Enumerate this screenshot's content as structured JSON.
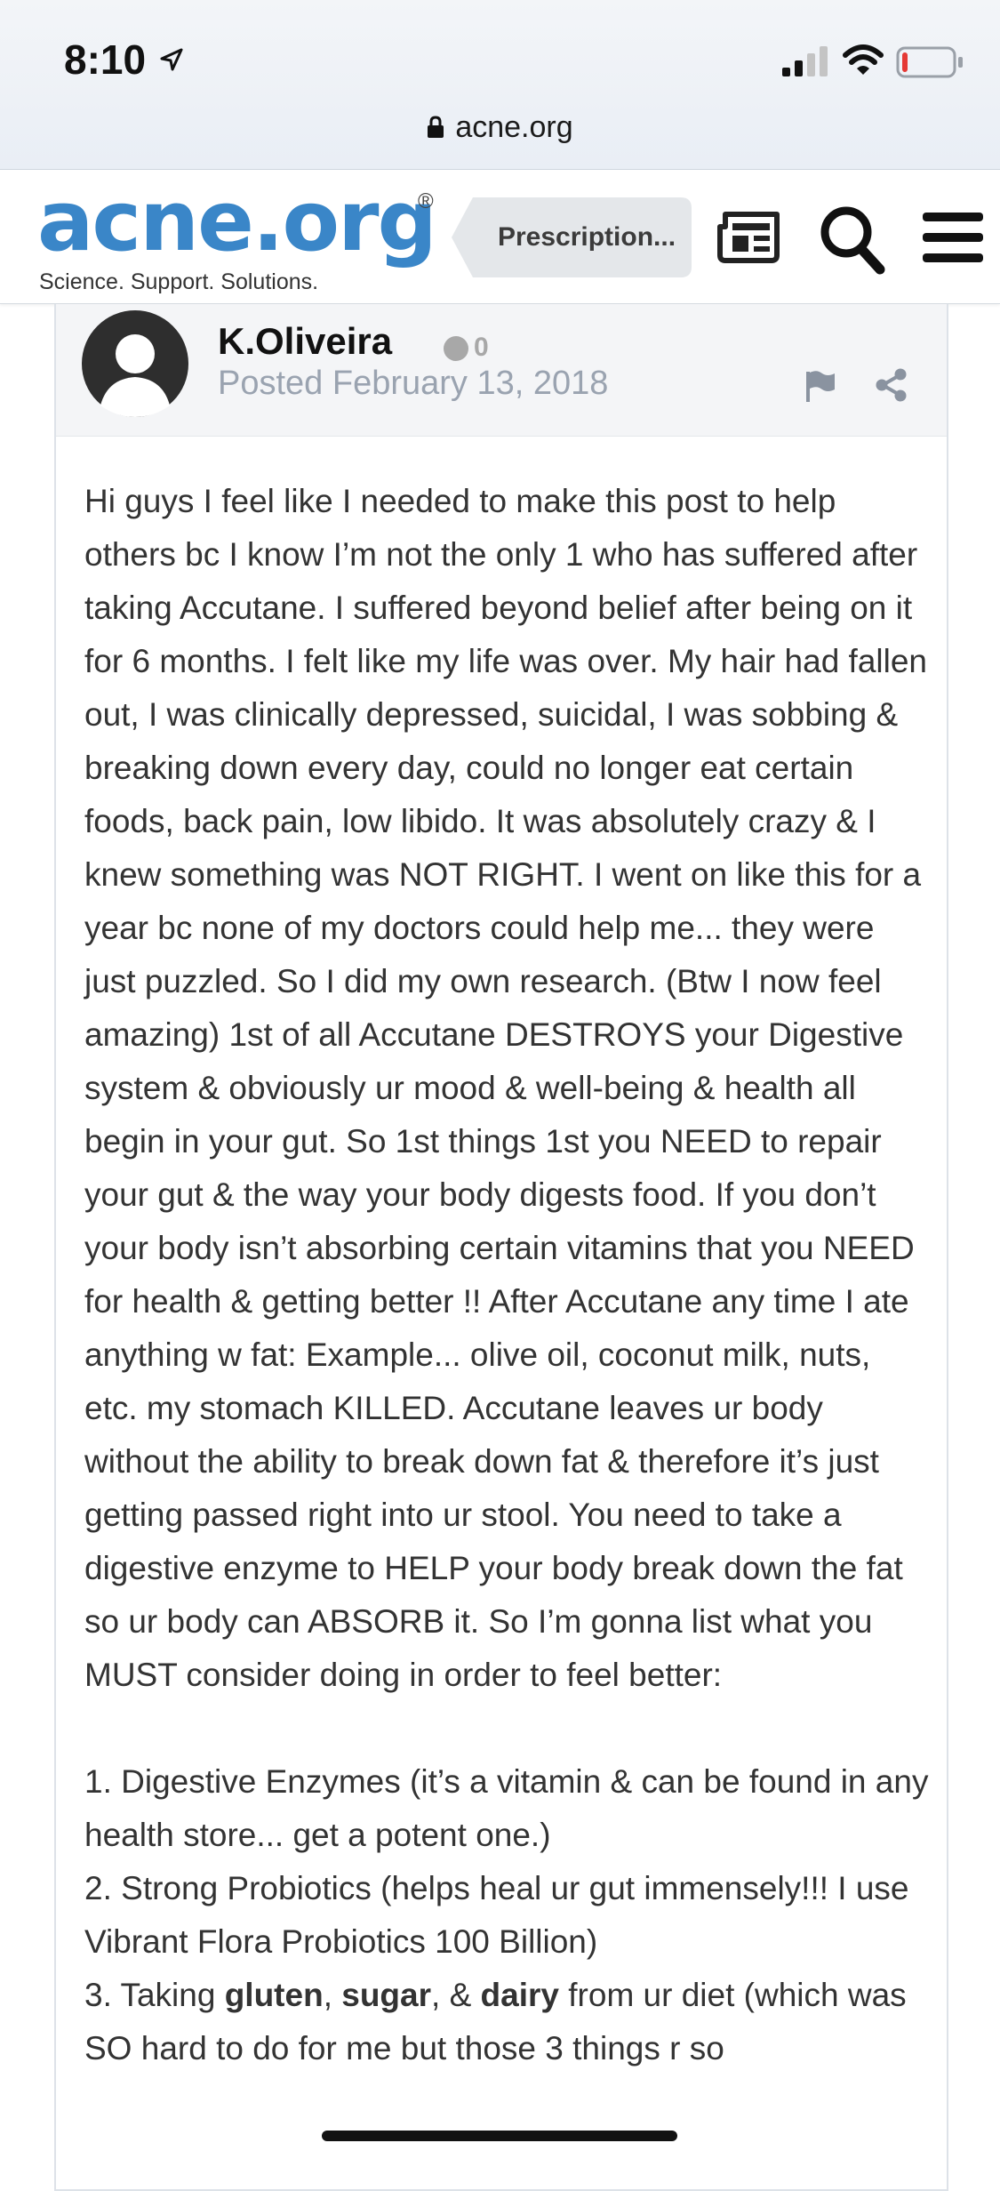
{
  "status_bar": {
    "time": "8:10",
    "icons": [
      "location-arrow-icon",
      "signal-icon",
      "wifi-icon",
      "battery-low-icon"
    ]
  },
  "browser": {
    "url": "acne.org"
  },
  "site_header": {
    "logo": "acne.org",
    "logo_mark": "®",
    "tagline": "Science. Support. Solutions.",
    "forum_button": "Prescription...",
    "icons": [
      "newspaper-icon",
      "search-icon",
      "hamburger-menu-icon"
    ],
    "logo_color": "#3a86c8"
  },
  "post": {
    "author": "K.Oliveira",
    "reputation": "0",
    "posted": "Posted February 13, 2018",
    "paragraph": "Hi guys I feel like I needed to make this post to help others bc I know I’m not the only 1 who has suffered after taking Accutane. I suffered beyond belief after being on it for 6 months. I felt like my life was over. My hair had fallen out, I was clinically depressed, suicidal, I was sobbing & breaking down every day, could no longer eat certain foods, back pain, low libido. It was absolutely crazy & I knew something was NOT RIGHT. I went on like this for a year bc none of my doctors could help me... they were just puzzled. So I did my own research. (Btw I now feel amazing) 1st of all Accutane DESTROYS your Digestive system & obviously ur mood & well-being & health all begin in your gut. So 1st things 1st you NEED to repair your gut & the way your body digests food. If you don’t your body isn’t absorbing certain vitamins that you NEED for health & getting better !! After Accutane any time I ate anything w fat: Example... olive oil, coconut milk, nuts, etc. my stomach KILLED. Accutane leaves ur body without the ability to break down fat & therefore it’s just getting passed right into ur stool. You need to take a digestive enzyme to HELP your body break down the fat so ur body can ABSORB it. So I’m gonna list what you MUST consider doing in order to feel better:",
    "list": [
      "1. Digestive Enzymes (it’s a vitamin & can be found in any health store... get a potent one.)",
      "2. Strong Probiotics (helps heal ur gut immensely!!! I use Vibrant Flora Probiotics 100 Billion)"
    ],
    "item3": {
      "prefix": "3. Taking ",
      "gluten": "gluten",
      "comma1": ", ",
      "sugar": "sugar",
      "comma2": ", & ",
      "dairy": "dairy",
      "rest": " from ur diet (which was SO hard to do for me but those 3 things r so"
    }
  }
}
